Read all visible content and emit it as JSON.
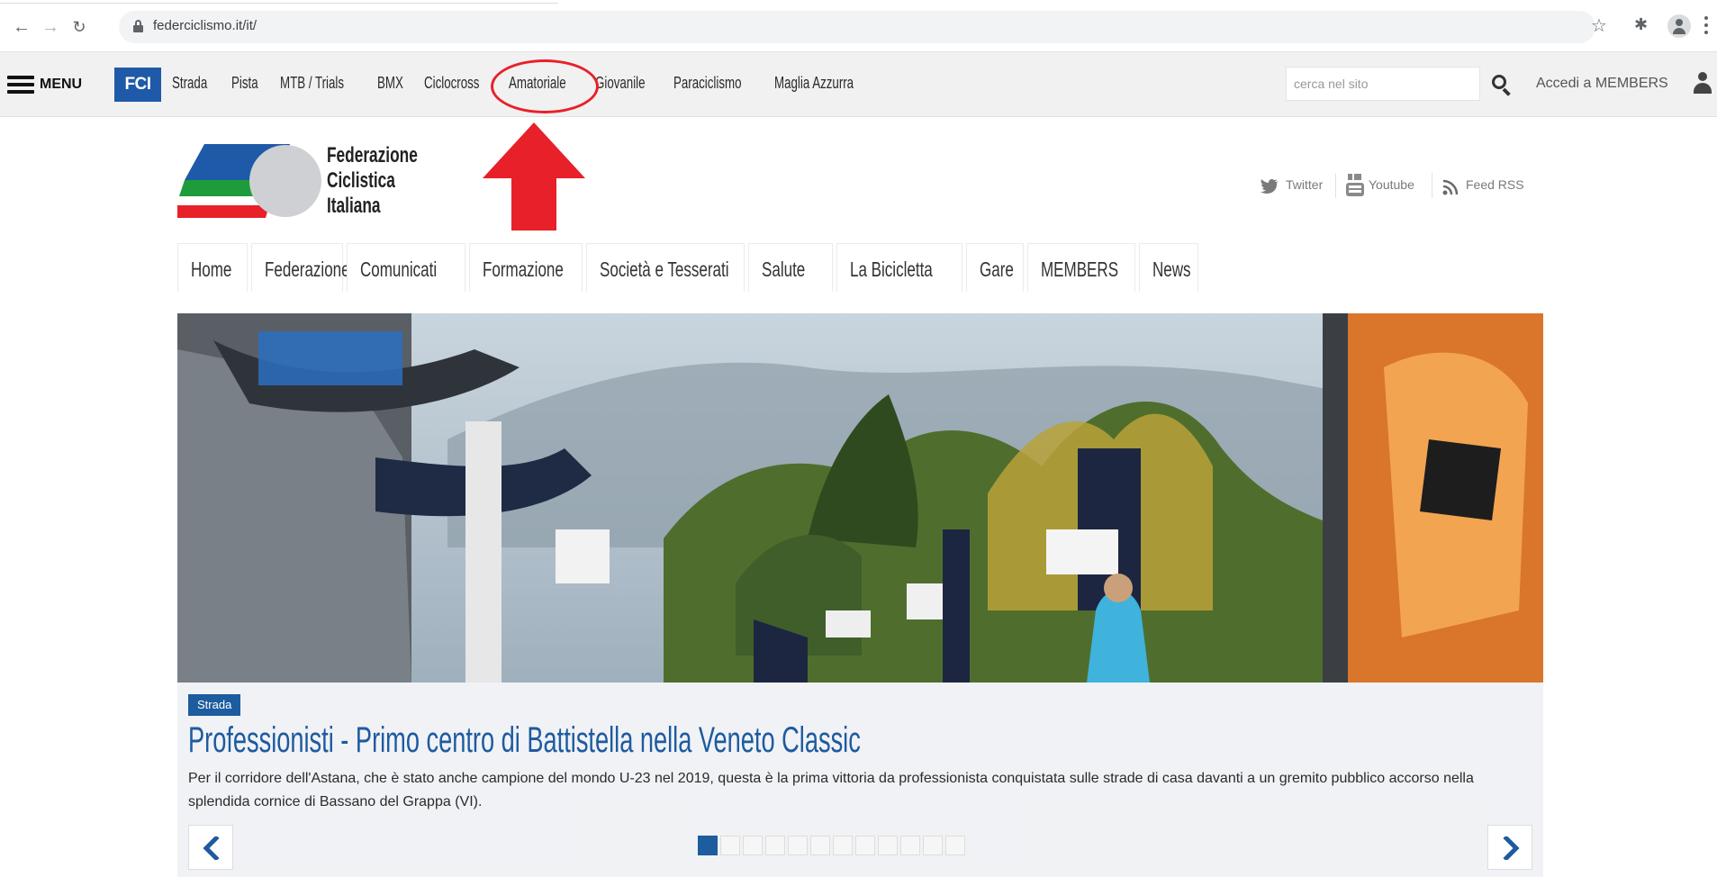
{
  "browser": {
    "url": "federciclismo.it/it/",
    "back_icon": "arrow-left",
    "forward_icon": "arrow-right",
    "reload_icon": "reload",
    "bookmark_icon": "star",
    "extensions_icon": "puzzle",
    "profile_icon": "person"
  },
  "topbar": {
    "menu_label": "MENU",
    "fci_logo_text": "FCI",
    "nav_items": [
      "Strada",
      "Pista",
      "MTB / Trials",
      "BMX",
      "Ciclocross",
      "Amatoriale",
      "Giovanile",
      "Paraciclismo",
      "Maglia Azzurra"
    ],
    "search_placeholder": "cerca nel sito",
    "members_login": "Accedi a MEMBERS"
  },
  "annotation": {
    "highlighted_item": "Amatoriale",
    "color": "#e8202a"
  },
  "federation": {
    "name_lines": [
      "Federazione",
      "Ciclistica",
      "Italiana"
    ]
  },
  "social": {
    "twitter": "Twitter",
    "youtube": "Youtube",
    "rss": "Feed RSS"
  },
  "main_nav": [
    "Home",
    "Federazione",
    "Comunicati",
    "Formazione",
    "Società e Tesserati",
    "Salute",
    "La Bicicletta",
    "Gare",
    "MEMBERS",
    "News"
  ],
  "hero": {
    "badge": "Strada",
    "headline": "Professionisti - Primo centro di Battistella nella Veneto Classic",
    "summary": "Per il corridore dell'Astana, che è stato anche campione del mondo U-23 nel 2019, questa è la prima vittoria da professionista conquistata sulle strade di casa davanti a un gremito pubblico accorso nella splendida cornice di Bassano del Grappa (VI).",
    "slide_count": 12,
    "active_slide": 1
  },
  "colors": {
    "brand_blue": "#1f5aa8",
    "headline_blue": "#1e5aa0",
    "annotation_red": "#e8202a"
  }
}
